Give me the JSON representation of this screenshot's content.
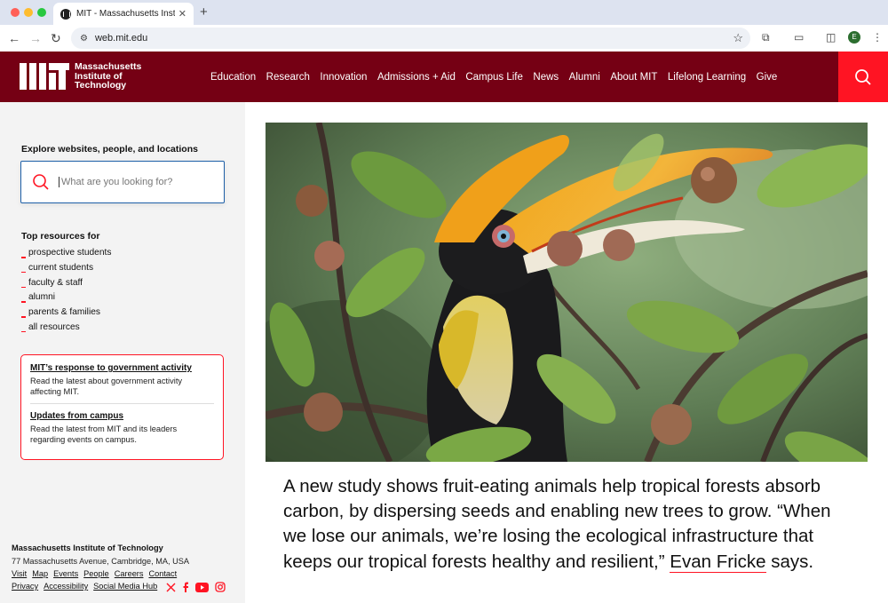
{
  "browser": {
    "tab_title": "MIT - Massachusetts Institute",
    "url": "web.mit.edu",
    "profile_initial": "E"
  },
  "header": {
    "logo_line1": "Massachusetts",
    "logo_line2": "Institute of",
    "logo_line3": "Technology",
    "nav": [
      "Education",
      "Research",
      "Innovation",
      "Admissions + Aid",
      "Campus Life",
      "News",
      "Alumni",
      "About MIT",
      "Lifelong Learning",
      "Give"
    ],
    "search_icon": "search-icon"
  },
  "sidebar": {
    "explore_heading": "Explore websites, people, and locations",
    "search_placeholder": "What are you looking for?",
    "top_heading": "Top resources for",
    "resources": [
      "prospective students",
      "current students",
      "faculty & staff",
      "alumni",
      "parents & families",
      "all resources"
    ],
    "notices": [
      {
        "title": "MIT’s response to government activity",
        "text": "Read the latest about government activity affecting MIT."
      },
      {
        "title": "Updates from campus",
        "text": "Read the latest from MIT and its leaders regarding events on campus."
      }
    ]
  },
  "footer": {
    "name": "Massachusetts Institute of Technology",
    "address": "77 Massachusetts Avenue, Cambridge, MA, USA",
    "links_row1": [
      "Visit",
      "Map",
      "Events",
      "People",
      "Careers",
      "Contact"
    ],
    "links_row2": [
      "Privacy",
      "Accessibility",
      "Social Media Hub"
    ],
    "social_icons": [
      "x-icon",
      "facebook-icon",
      "youtube-icon",
      "instagram-icon"
    ]
  },
  "main": {
    "caption_before": "A new study shows fruit-eating animals help tropical forests absorb carbon, by dispersing seeds and enabling new trees to grow. “When we lose our animals, we’re losing the ecological infrastructure that keeps our tropical forests healthy and resilient,”",
    "caption_link": "Evan Fricke",
    "caption_after": " says."
  },
  "colors": {
    "brand": "#750014",
    "accent": "#ff1423",
    "focus": "#1d5fa7"
  }
}
